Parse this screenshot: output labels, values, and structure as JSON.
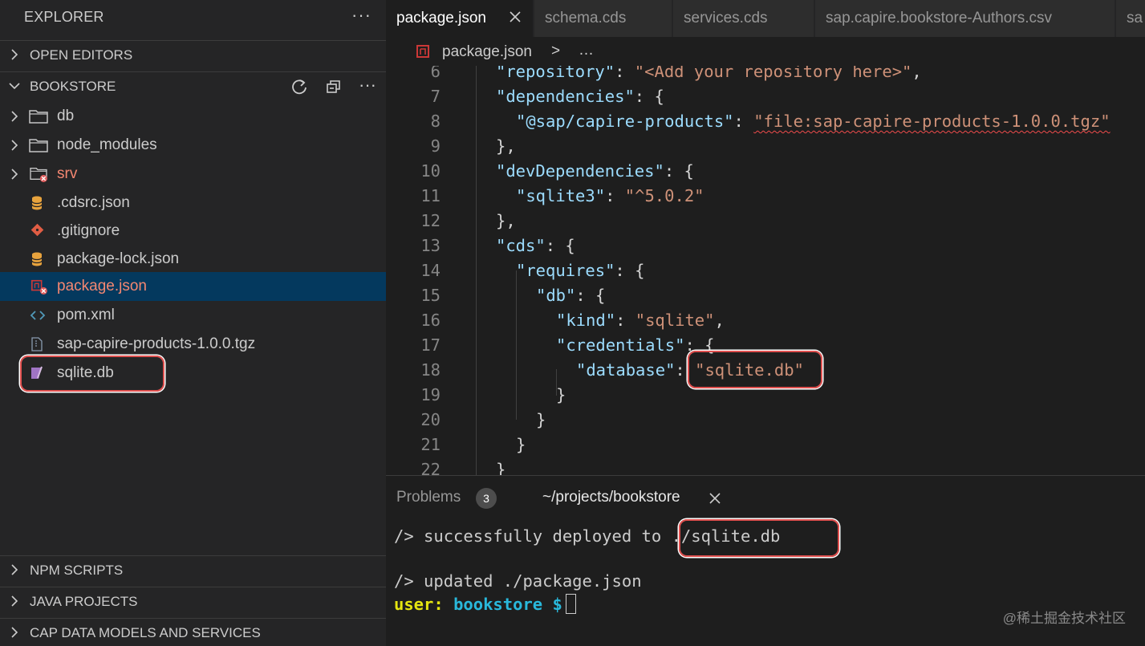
{
  "sidebar": {
    "title": "EXPLORER",
    "more": "···",
    "sections": {
      "open_editors": "OPEN EDITORS",
      "bookstore": "BOOKSTORE",
      "npm_scripts": "NPM SCRIPTS",
      "java_projects": "JAVA PROJECTS",
      "cap_data_models": "CAP DATA MODELS AND SERVICES"
    },
    "tree": [
      {
        "label": "db",
        "type": "folder"
      },
      {
        "label": "node_modules",
        "type": "folder"
      },
      {
        "label": "srv",
        "type": "folder",
        "status": "error"
      },
      {
        "label": ".cdsrc.json",
        "type": "db-file"
      },
      {
        "label": ".gitignore",
        "type": "git-file"
      },
      {
        "label": "package-lock.json",
        "type": "db-file"
      },
      {
        "label": "package.json",
        "type": "npm-file",
        "status": "error",
        "selected": true
      },
      {
        "label": "pom.xml",
        "type": "xml-file"
      },
      {
        "label": "sap-capire-products-1.0.0.tgz",
        "type": "archive-file"
      },
      {
        "label": "sqlite.db",
        "type": "sqlite-file",
        "highlighted": true
      }
    ]
  },
  "tabs": [
    {
      "label": "package.json",
      "active": true
    },
    {
      "label": "schema.cds"
    },
    {
      "label": "services.cds"
    },
    {
      "label": "sap.capire.bookstore-Authors.csv"
    },
    {
      "label": "sa"
    }
  ],
  "breadcrumb": {
    "file": "package.json",
    "separator": ">",
    "more": "…"
  },
  "editor": {
    "lines": [
      {
        "n": "6",
        "indent": 0,
        "key": "repository",
        "rest": ": ",
        "val": "<Add your repository here>",
        "tail": ","
      },
      {
        "n": "7",
        "indent": 0,
        "key": "dependencies",
        "rest": ": {"
      },
      {
        "n": "8",
        "indent": 1,
        "key": "@sap/capire-products",
        "rest": ": ",
        "val": "file:sap-capire-products-1.0.0.tgz",
        "squiggle": true
      },
      {
        "n": "9",
        "indent": 0,
        "plain": "},"
      },
      {
        "n": "10",
        "indent": 0,
        "key": "devDependencies",
        "rest": ": {"
      },
      {
        "n": "11",
        "indent": 1,
        "key": "sqlite3",
        "rest": ": ",
        "val": "^5.0.2"
      },
      {
        "n": "12",
        "indent": 0,
        "plain": "},"
      },
      {
        "n": "13",
        "indent": 0,
        "key": "cds",
        "rest": ": {"
      },
      {
        "n": "14",
        "indent": 1,
        "key": "requires",
        "rest": ": {"
      },
      {
        "n": "15",
        "indent": 2,
        "key": "db",
        "rest": ": {"
      },
      {
        "n": "16",
        "indent": 3,
        "key": "kind",
        "rest": ": ",
        "val": "sqlite",
        "tail": ","
      },
      {
        "n": "17",
        "indent": 3,
        "key": "credentials",
        "rest": ": {"
      },
      {
        "n": "18",
        "indent": 4,
        "key": "database",
        "rest": ": ",
        "val": "sqlite.db"
      },
      {
        "n": "19",
        "indent": 3,
        "plain": "}"
      },
      {
        "n": "20",
        "indent": 2,
        "plain": "}"
      },
      {
        "n": "21",
        "indent": 1,
        "plain": "}"
      },
      {
        "n": "22",
        "indent": 0,
        "plain": "}"
      }
    ]
  },
  "panel": {
    "problems_label": "Problems",
    "problems_count": "3",
    "terminal_tab": "~/projects/bookstore",
    "terminal": {
      "line1_prefix": "/> successfully deployed to ",
      "line1_target": "./sqlite.db",
      "line2": "/> updated ./package.json",
      "prompt_user": "user:",
      "prompt_dir": "bookstore",
      "prompt_symbol": "$"
    }
  },
  "watermark": "@稀土掘金技术社区",
  "colors": {
    "selection": "#04395e",
    "highlight": "#e0504f",
    "error_label": "#f48771",
    "json_key": "#9cdcfe",
    "json_string": "#ce9178"
  }
}
